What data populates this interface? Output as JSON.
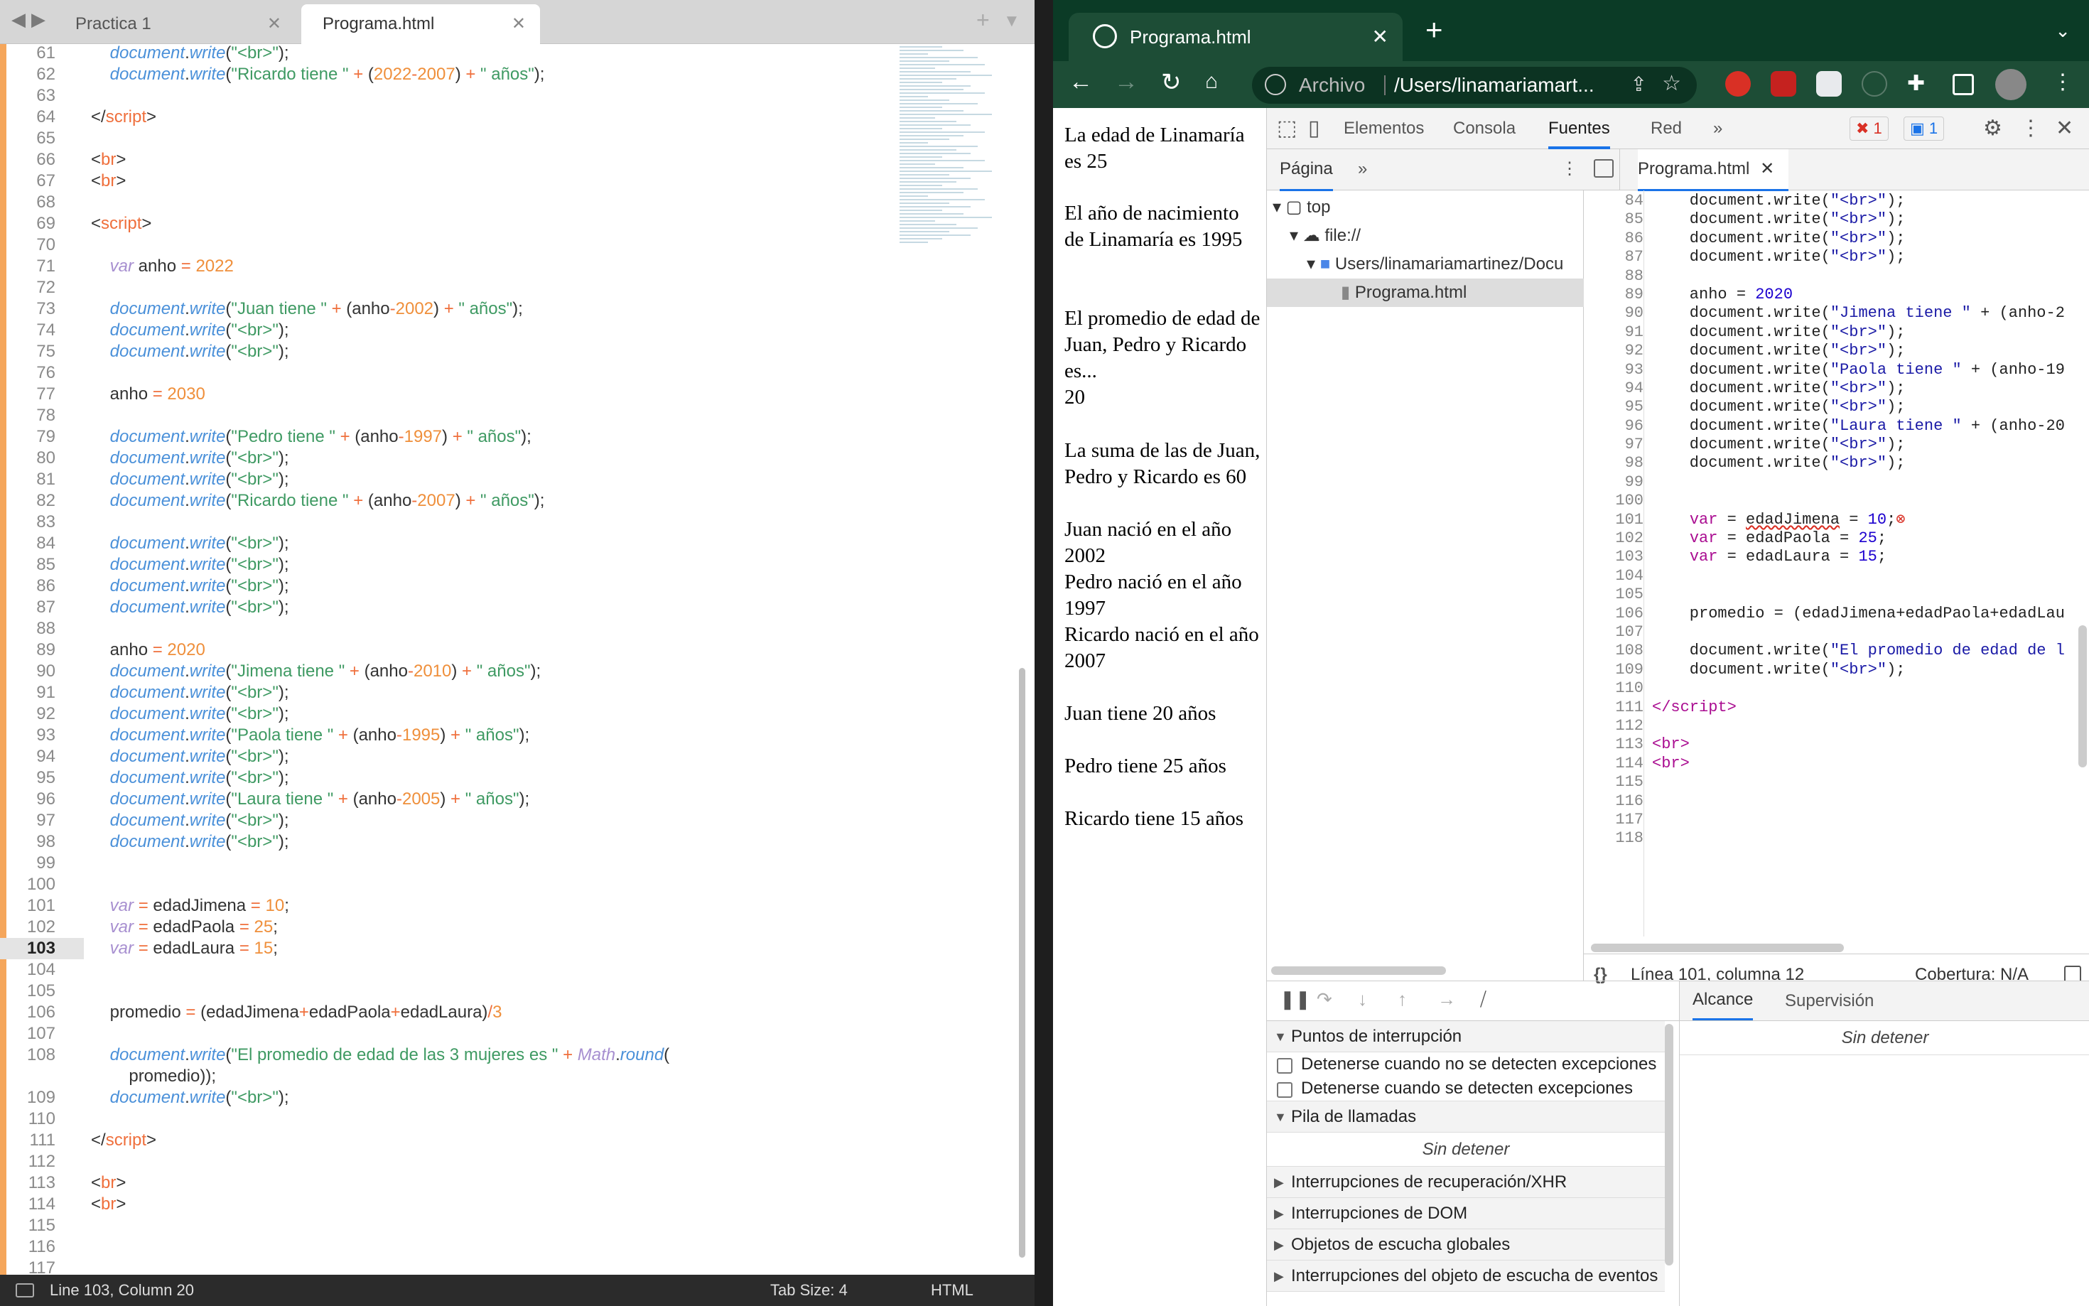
{
  "editor": {
    "tabs": [
      {
        "label": "Practica 1"
      },
      {
        "label": "Programa.html"
      }
    ],
    "status": {
      "position": "Line 103, Column 20",
      "tab_size": "Tab Size: 4",
      "syntax": "HTML"
    },
    "current_line": "103"
  },
  "chrome": {
    "tab_title": "Programa.html",
    "omnibox": {
      "scheme_label": "Archivo",
      "url": "/Users/linamariamart..."
    },
    "page_text": {
      "p1": "La edad de Linamaría es 25",
      "p2": "El año de nacimiento de Linamaría es 1995",
      "p3a": "El promedio de edad de Juan, Pedro y Ricardo es...",
      "p3b": "20",
      "p4": "La suma de las de Juan, Pedro y Ricardo es 60",
      "p5": "Juan nació en el año 2002",
      "p6": "Pedro nació en el año 1997",
      "p7": "Ricardo nació en el año 2007",
      "p8": "Juan tiene 20 años",
      "p9": "Pedro tiene 25 años",
      "p10": "Ricardo tiene 15 años"
    }
  },
  "devtools": {
    "tabs": {
      "elements": "Elementos",
      "console": "Consola",
      "sources": "Fuentes",
      "network": "Red"
    },
    "errors": "1",
    "messages": "1",
    "navigator": {
      "tab": "Página",
      "top": "top",
      "file": "file://",
      "folder": "Users/linamariamartinez/Docu",
      "document": "Programa.html"
    },
    "open_file": "Programa.html",
    "status": {
      "position": "Línea 101, columna 12",
      "coverage": "Cobertura: N/A"
    },
    "debugger": {
      "breakpoints": "Puntos de interrupción",
      "bp_uncaught": "Detenerse cuando no se detecten excepciones",
      "bp_caught": "Detenerse cuando se detecten excepciones",
      "callstack": "Pila de llamadas",
      "not_paused": "Sin detener",
      "xhr": "Interrupciones de recuperación/XHR",
      "dom": "Interrupciones de DOM",
      "listeners": "Objetos de escucha globales",
      "event_listeners": "Interrupciones del objeto de escucha de eventos",
      "scope": "Alcance",
      "watch": "Supervisión"
    }
  },
  "colors": {
    "accent": "#1a73e8",
    "chrome_frame": "#0b3b26",
    "gutter_marker": "#f5a65b"
  }
}
